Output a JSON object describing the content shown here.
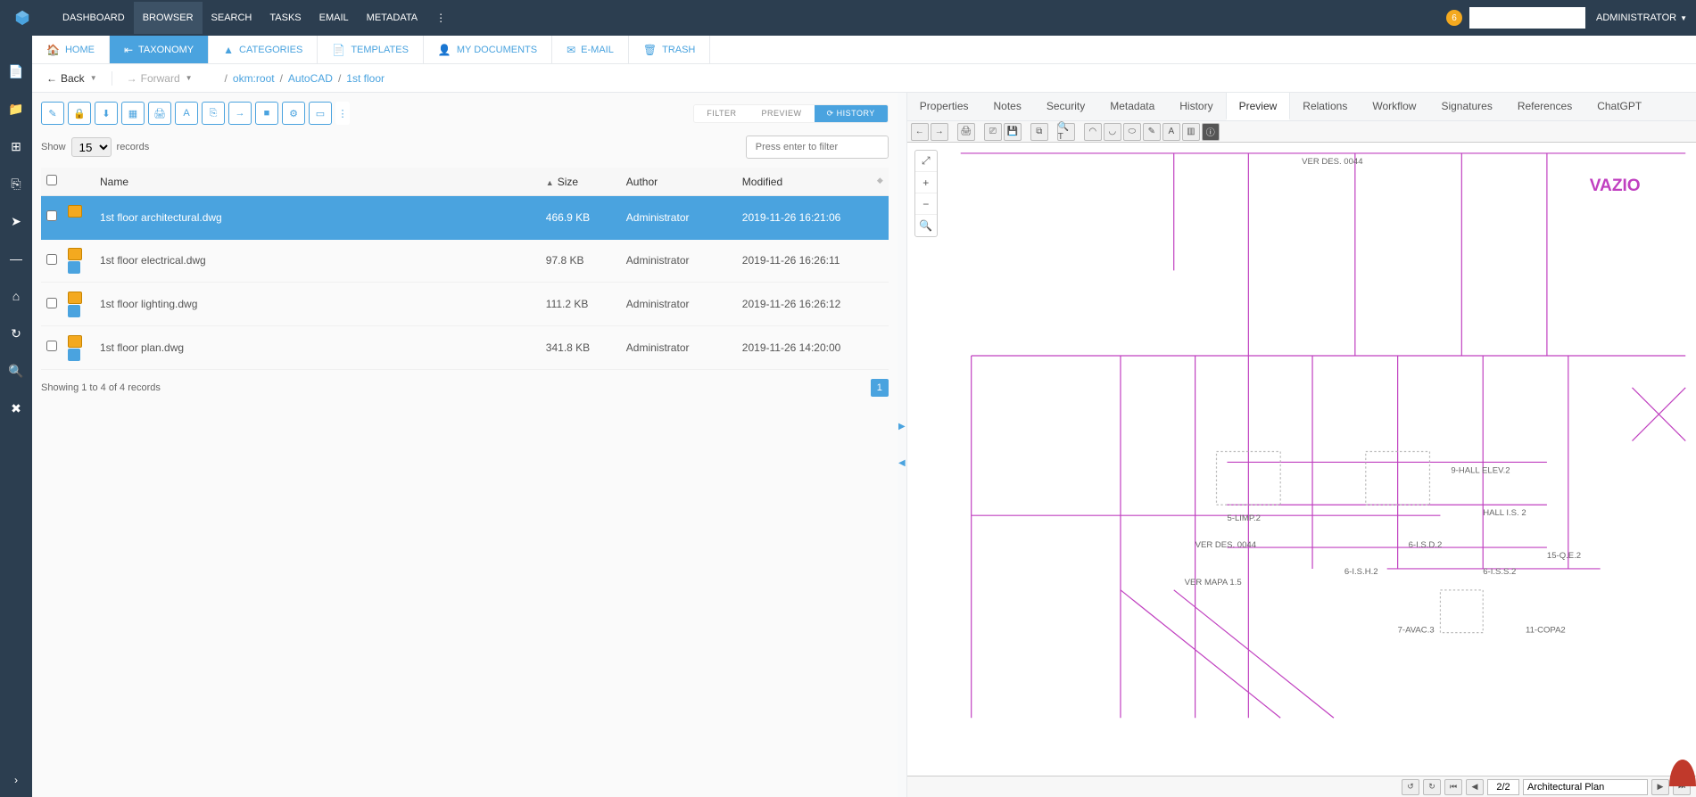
{
  "colors": {
    "accent": "#4aa3df",
    "navy": "#2c3e50",
    "badge": "#f4a91f"
  },
  "topbar": {
    "menu": [
      "DASHBOARD",
      "BROWSER",
      "SEARCH",
      "TASKS",
      "EMAIL",
      "METADATA"
    ],
    "active_index": 1,
    "badge_count": "6",
    "user_label": "ADMINISTRATOR"
  },
  "nav_tabs": {
    "items": [
      {
        "icon": "🏠",
        "label": "HOME"
      },
      {
        "icon": "⇤",
        "label": "TAXONOMY"
      },
      {
        "icon": "▲",
        "label": "CATEGORIES"
      },
      {
        "icon": "📄",
        "label": "TEMPLATES"
      },
      {
        "icon": "👤",
        "label": "MY DOCUMENTS"
      },
      {
        "icon": "✉",
        "label": "E-MAIL"
      },
      {
        "icon": "🗑",
        "label": "TRASH"
      }
    ],
    "active_index": 1
  },
  "breadcrumb": {
    "back_label": "Back",
    "forward_label": "Forward",
    "path": [
      "okm:root",
      "AutoCAD",
      "1st floor"
    ]
  },
  "list_controls": {
    "show_label": "Show",
    "count_value": "15",
    "records_label": "records",
    "filter_placeholder": "Press enter to filter",
    "subtabs": [
      "FILTER",
      "PREVIEW",
      "HISTORY"
    ],
    "subtab_active_index": 2
  },
  "table": {
    "columns": [
      "",
      "",
      "Name",
      "Size",
      "Author",
      "Modified"
    ],
    "sort_col": "Size",
    "rows": [
      {
        "name": "1st floor architectural.dwg",
        "size": "466.9 KB",
        "author": "Administrator",
        "modified": "2019-11-26 16:21:06",
        "selected": true
      },
      {
        "name": "1st floor electrical.dwg",
        "size": "97.8 KB",
        "author": "Administrator",
        "modified": "2019-11-26 16:26:11",
        "selected": false
      },
      {
        "name": "1st floor lighting.dwg",
        "size": "111.2 KB",
        "author": "Administrator",
        "modified": "2019-11-26 16:26:12",
        "selected": false
      },
      {
        "name": "1st floor plan.dwg",
        "size": "341.8 KB",
        "author": "Administrator",
        "modified": "2019-11-26 14:20:00",
        "selected": false
      }
    ],
    "footer_text": "Showing 1 to 4 of 4 records",
    "page_number": "1"
  },
  "preview_tabs": {
    "items": [
      "Properties",
      "Notes",
      "Security",
      "Metadata",
      "History",
      "Preview",
      "Relations",
      "Workflow",
      "Signatures",
      "References",
      "ChatGPT"
    ],
    "active_index": 5
  },
  "viewer": {
    "overlay_text": "VAZIO",
    "page_indicator": "2/2",
    "layer_name": "Architectural Plan",
    "annotations": {
      "ver_des": "VER DES. 0044",
      "ver_mapa": "VER MAPA 1.5",
      "hall_elev": "9-HALL ELEV.2",
      "hall_is": "HALL I.S. 2",
      "slimp": "5-LIMP.2",
      "sqe": "15-Q.E.2",
      "sisd": "6-I.S.D.2",
      "sish": "6-I.S.H.2",
      "sissz": "6-I.S.S.2",
      "avac": "7-AVAC.3",
      "copa": "11-COPA2"
    }
  }
}
